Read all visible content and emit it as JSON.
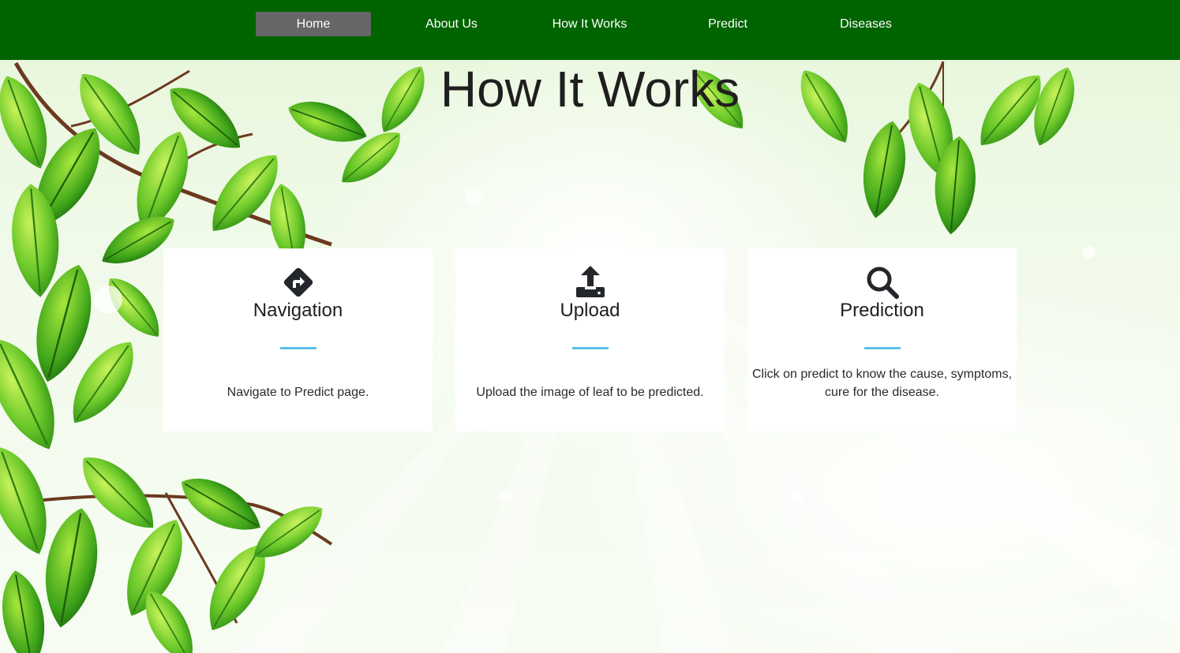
{
  "nav": {
    "items": [
      {
        "label": "Home",
        "active": true
      },
      {
        "label": "About Us",
        "active": false
      },
      {
        "label": "How It Works",
        "active": false
      },
      {
        "label": "Predict",
        "active": false
      },
      {
        "label": "Diseases",
        "active": false
      }
    ]
  },
  "main": {
    "title": "How It Works",
    "cards": [
      {
        "icon": "directions-sign-icon",
        "title": "Navigation",
        "text_lines": [
          "Navigate to Predict page."
        ]
      },
      {
        "icon": "upload-icon",
        "title": "Upload",
        "text_lines": [
          "Upload the image of leaf to be predicted."
        ]
      },
      {
        "icon": "search-icon",
        "title": "Prediction",
        "text_lines": [
          "Click on predict to know the cause, symptoms,",
          "cure for the disease."
        ]
      }
    ]
  },
  "colors": {
    "navbar": "#006400",
    "active_nav": "#666666",
    "accent_rule": "#5bc0eb",
    "leaf": "#5cc21f"
  }
}
